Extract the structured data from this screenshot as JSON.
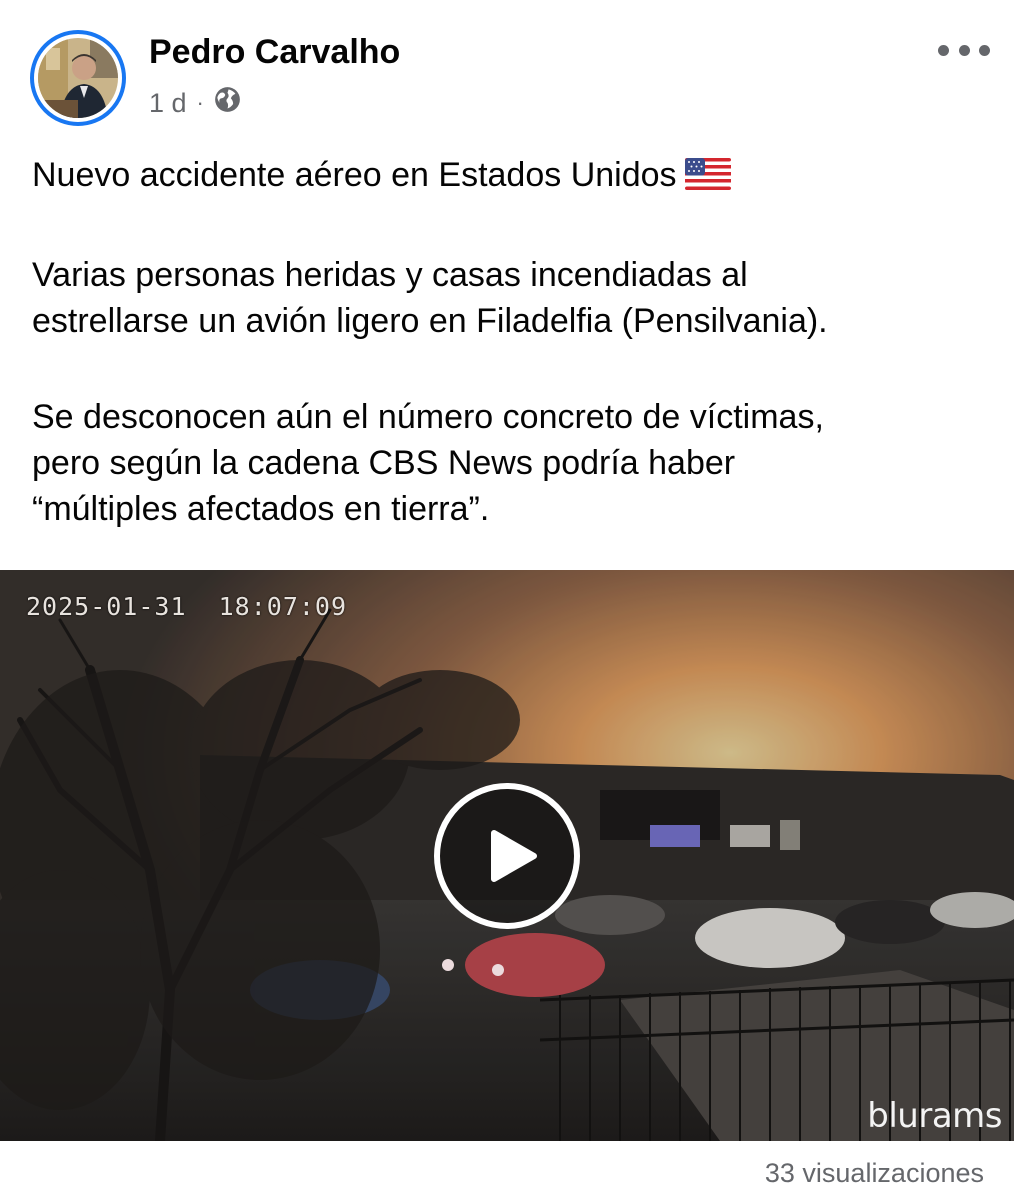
{
  "post": {
    "author": "Pedro Carvalho",
    "time": "1 d",
    "separator": "·",
    "audience_icon": "globe-icon",
    "more_icon": "more-options-icon",
    "text_lines": [
      "Nuevo accidente aéreo en Estados Unidos",
      "Varias personas heridas y casas incendiadas al",
      "estrellarse un avión ligero en Filadelfia (Pensilvania).",
      "Se desconocen aún el número concreto de víctimas,",
      "pero según la cadena CBS News podría haber",
      "“múltiples afectados en tierra”."
    ],
    "flag_emoji": "us-flag"
  },
  "video": {
    "timestamp": "2025-01-31  18:07:09",
    "watermark": "blurams",
    "play_icon": "play-icon"
  },
  "footer": {
    "views": "33 visualizaciones"
  },
  "colors": {
    "accent": "#1877f2",
    "secondary_text": "#65676b",
    "primary_text": "#050505"
  }
}
